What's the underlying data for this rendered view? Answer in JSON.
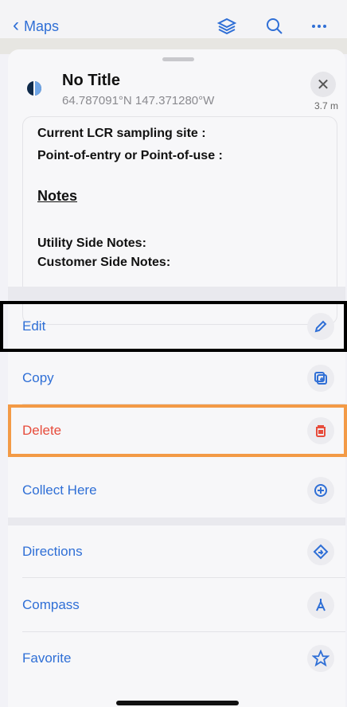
{
  "nav": {
    "back_label": "Maps"
  },
  "place": {
    "title": "No Title",
    "coords": "64.787091°N 147.371280°W",
    "distance": "3.7 m"
  },
  "card": {
    "line1": "Current LCR sampling site :",
    "line2": "Point-of-entry or Point-of-use :",
    "notes_header": "Notes",
    "line3": "Utility Side Notes:",
    "line4": "Customer Side Notes:"
  },
  "actions": {
    "edit": "Edit",
    "copy": "Copy",
    "delete": "Delete",
    "collect_here": "Collect Here",
    "directions": "Directions",
    "compass": "Compass",
    "favorite": "Favorite"
  },
  "colors": {
    "accent": "#2f6fd6",
    "danger": "#e74c3c",
    "highlight_black": "#000000",
    "highlight_orange": "#f39a46"
  }
}
